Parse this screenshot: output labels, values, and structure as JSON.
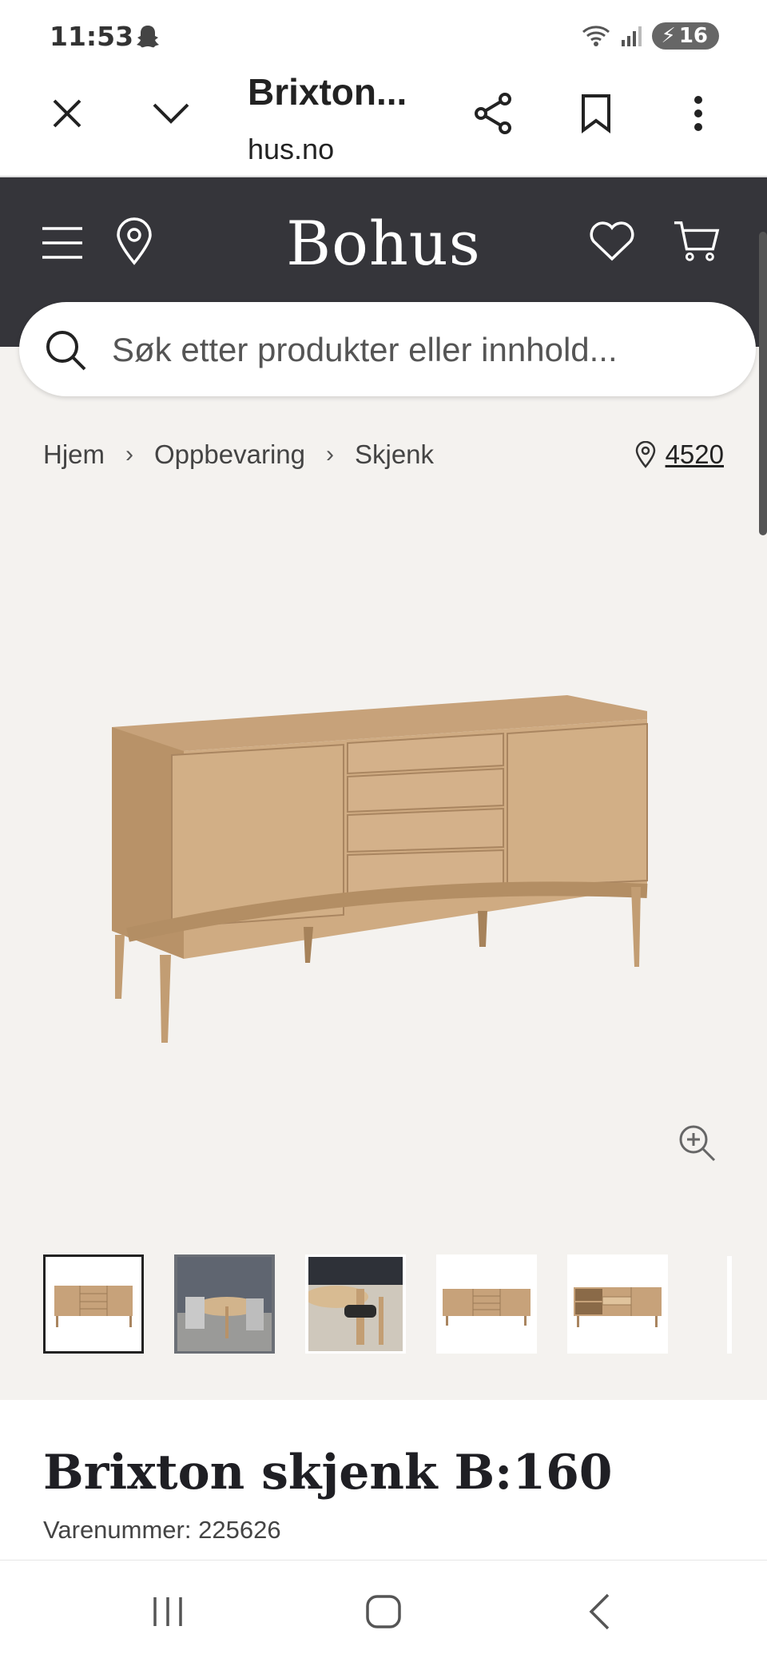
{
  "status_bar": {
    "time": "11:53",
    "battery": "16"
  },
  "browser": {
    "title": "Brixton...",
    "domain": "hus.no"
  },
  "header": {
    "logo": "Bohus"
  },
  "search": {
    "placeholder": "Søk etter produkter eller innhold..."
  },
  "breadcrumb": {
    "items": [
      "Hjem",
      "Oppbevaring",
      "Skjenk"
    ],
    "store_number": "4520"
  },
  "gallery": {
    "thumbnail_count": 5,
    "selected_index": 0
  },
  "product": {
    "title": "Brixton skjenk B:160",
    "sku_label": "Varenummer:",
    "sku": "225626"
  },
  "colors": {
    "header_bg": "#35353a",
    "page_bg": "#f4f2ef",
    "wood": "#c9a57c"
  }
}
